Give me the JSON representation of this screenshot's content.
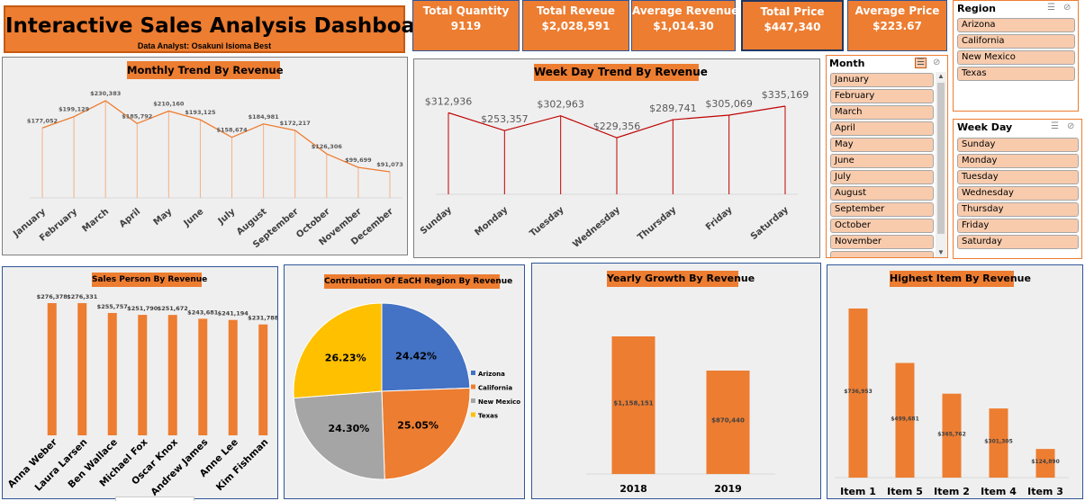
{
  "header": {
    "title": "Interactive Sales Analysis Dashboard",
    "subtitle": "Data Analyst: Osakuni Isioma Best"
  },
  "kpis": [
    {
      "label": "Total Quantity",
      "value": "9119"
    },
    {
      "label": "Total Reveue",
      "value": "$2,028,591"
    },
    {
      "label": "Average Revenue",
      "value": "$1,014.30"
    },
    {
      "label": "Total Price",
      "value": "$447,340"
    },
    {
      "label": "Average Price",
      "value": "$223.67"
    }
  ],
  "slicers": {
    "region": {
      "title": "Region",
      "items": [
        "Arizona",
        "California",
        "New Mexico",
        "Texas"
      ]
    },
    "month": {
      "title": "Month",
      "items": [
        "January",
        "February",
        "March",
        "April",
        "May",
        "June",
        "July",
        "August",
        "September",
        "October",
        "November"
      ]
    },
    "weekday": {
      "title": "Week Day",
      "items": [
        "Sunday",
        "Monday",
        "Tuesday",
        "Wednesday",
        "Thursday",
        "Friday",
        "Saturday"
      ]
    }
  },
  "colors": {
    "accent": "#ED7D31",
    "line_red": "#C00000",
    "slicer_item": "#F8CBAD",
    "arizona": "#4472C4",
    "california": "#ED7D31",
    "new_mexico": "#A5A5A5",
    "texas": "#FFC000"
  },
  "chart_data": [
    {
      "id": "monthly",
      "type": "line",
      "title": "Monthly Trend By Revenue",
      "categories": [
        "January",
        "February",
        "March",
        "April",
        "May",
        "June",
        "July",
        "August",
        "September",
        "October",
        "November",
        "December"
      ],
      "values": [
        177052,
        199129,
        230383,
        185792,
        210160,
        193125,
        158674,
        184981,
        172217,
        126306,
        99699,
        91073
      ],
      "labels": [
        "$177,052",
        "$199,129",
        "$230,383",
        "$185,792",
        "$210,160",
        "$193,125",
        "$158,674",
        "$184,981",
        "$172,217",
        "$126,306",
        "$99,699",
        "$91,073"
      ],
      "drop_lines": true
    },
    {
      "id": "weekday",
      "type": "line",
      "title": "Week Day Trend By Revenue",
      "categories": [
        "Sunday",
        "Monday",
        "Tuesday",
        "Wednesday",
        "Thursday",
        "Friday",
        "Saturday"
      ],
      "values": [
        312936,
        253357,
        302963,
        229356,
        289741,
        305069,
        335169
      ],
      "labels": [
        "$312,936",
        "$253,357",
        "$302,963",
        "$229,356",
        "$289,741",
        "$305,069",
        "$335,169"
      ],
      "drop_lines": true
    },
    {
      "id": "salesperson",
      "type": "bar",
      "title": "Sales Person By Revenue",
      "categories": [
        "Anna Weber",
        "Laura Larsen",
        "Ben Wallace",
        "Michael Fox",
        "Oscar Knox",
        "Andrew James",
        "Anne Lee",
        "Kim Fishman"
      ],
      "values": [
        276378,
        276331,
        255757,
        251790,
        251672,
        243681,
        241194,
        231788
      ],
      "labels": [
        "$276,378",
        "$276,331",
        "$255,757",
        "$251,790",
        "$251,672",
        "$243,681",
        "$241,194",
        "$231,788"
      ]
    },
    {
      "id": "region",
      "type": "pie",
      "title": "Contribution Of EaCH Region By Revenue",
      "categories": [
        "Arizona",
        "California",
        "New Mexico",
        "Texas"
      ],
      "values": [
        24.42,
        25.05,
        24.3,
        26.23
      ],
      "labels": [
        "24.42%",
        "25.05%",
        "24.30%",
        "26.23%"
      ],
      "legend": "right"
    },
    {
      "id": "yearly",
      "type": "bar",
      "title": "Yearly Growth By Revenue",
      "categories": [
        "2018",
        "2019"
      ],
      "values": [
        1158151,
        870440
      ],
      "labels": [
        "$1,158,151",
        "$870,440"
      ]
    },
    {
      "id": "items",
      "type": "bar",
      "title": "Highest Item By Revenue",
      "categories": [
        "Item 1",
        "Item 5",
        "Item 2",
        "Item 4",
        "Item 3"
      ],
      "values": [
        736953,
        499681,
        365762,
        301305,
        124890
      ],
      "labels": [
        "$736,953",
        "$499,681",
        "$365,762",
        "$301,305",
        "$124,890"
      ]
    }
  ]
}
